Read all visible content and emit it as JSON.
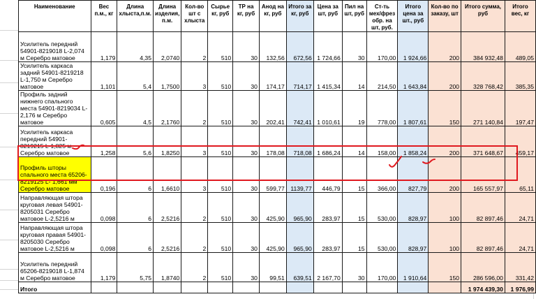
{
  "sheet": {
    "headers": [
      "Наименование",
      "Вес п.м., кг",
      "Длина хлыста,п.м.",
      "Длина изделия, п.м.",
      "Кол-во шт с хлыста",
      "Сырье кг, руб",
      "ТР на кг, руб",
      "Анод на кг, руб",
      "Итого за кг, руб",
      "Цена за шт, руб",
      "Пил на шт, руб",
      "Ст-ть мех/фрез обр. на шт, руб.",
      "Итого цена за шт., руб",
      "Кол-во по заказу, шт",
      "Итого сумма, руб",
      "Итого вес, кг"
    ],
    "rows": [
      {
        "name": "Усилитель передний 54901-8219018 L-2,074 м Серебро матовое",
        "cells": [
          "1,179",
          "4,35",
          "2,0740",
          "2",
          "510",
          "30",
          "132,56",
          "672,56",
          "1 724,66",
          "30",
          "170,00",
          "1 924,66",
          "200",
          "384 932,48",
          "489,05"
        ]
      },
      {
        "name": "Усилитель каркаса задний 54901-8219218 L-1,750 м Серебро матовое",
        "cells": [
          "1,101",
          "5,4",
          "1,7500",
          "3",
          "510",
          "30",
          "174,17",
          "714,17",
          "1 415,34",
          "14",
          "214,50",
          "1 643,84",
          "200",
          "328 768,42",
          "385,35"
        ]
      },
      {
        "name": "Профиль задний нижнего спального места 54901-8219034 L-2,176 м Серебро матовое",
        "cells": [
          "0,605",
          "4,5",
          "2,1760",
          "2",
          "510",
          "30",
          "202,41",
          "742,41",
          "1 010,61",
          "19",
          "778,00",
          "1 807,61",
          "150",
          "271 140,84",
          "197,47"
        ]
      },
      {
        "name": "Усилитель каркаса передний 54901-8219215 L-1,825 м Серебро матовое",
        "cells": [
          "1,258",
          "5,6",
          "1,8250",
          "3",
          "510",
          "30",
          "178,08",
          "718,08",
          "1 686,24",
          "14",
          "158,00",
          "1 858,24",
          "200",
          "371 648,67",
          "459,17"
        ]
      },
      {
        "name": "Профиль шторы спального места 65206-8219125 L- 1,661 мм Серебро матовое",
        "cells": [
          "0,196",
          "6",
          "1,6610",
          "3",
          "510",
          "30",
          "599,77",
          "1139,77",
          "446,79",
          "15",
          "366,00",
          "827,79",
          "200",
          "165 557,97",
          "65,11"
        ]
      },
      {
        "name": "Направляющая шторa круговая левая 54901-8205031 Серебро матовое L-2,5216 м",
        "cells": [
          "0,098",
          "6",
          "2,5216",
          "2",
          "510",
          "30",
          "425,90",
          "965,90",
          "283,97",
          "15",
          "530,00",
          "828,97",
          "100",
          "82 897,46",
          "24,71"
        ]
      },
      {
        "name": "Направляющая шторa круговая правая 54901-8205030 Серебро матовое L-2,5216 м",
        "cells": [
          "0,098",
          "6",
          "2,5216",
          "2",
          "510",
          "30",
          "425,90",
          "965,90",
          "283,97",
          "15",
          "530,00",
          "828,97",
          "100",
          "82 897,46",
          "24,71"
        ]
      },
      {
        "name": "Усилитель передний 65206-8219018 L-1,874 м Серебро матовое",
        "cells": [
          "1,179",
          "5,75",
          "1,8740",
          "2",
          "510",
          "30",
          "99,51",
          "639,51",
          "2 167,70",
          "30",
          "170,00",
          "1 910,64",
          "150",
          "286 596,00",
          "331,42"
        ]
      }
    ],
    "total": {
      "label": "Итого",
      "sum": "1 974 439,30",
      "weight": "1 976,99"
    }
  },
  "colors": {
    "blue_column": "#dce9f6",
    "peach_column": "#fbe1d3",
    "highlight": "#ffff00",
    "selection_border": "#e0191f"
  }
}
